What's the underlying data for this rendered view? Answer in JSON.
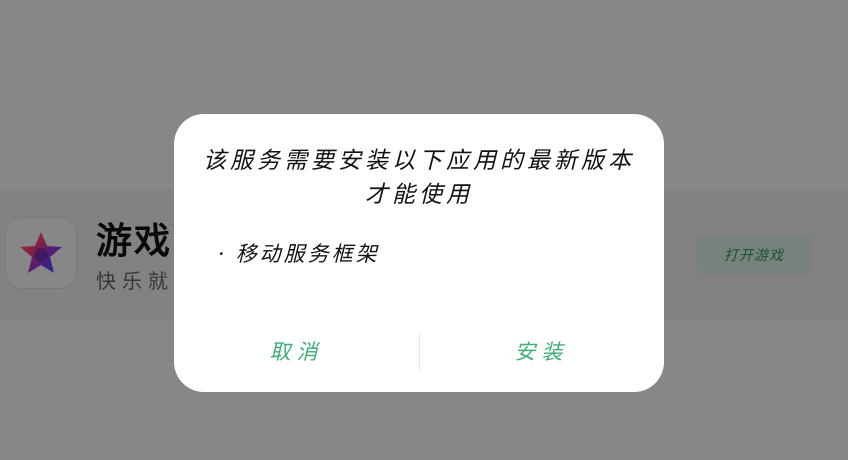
{
  "background_app": {
    "name": "游戏",
    "slogan": "快乐就",
    "open_button_label": "打开游戏"
  },
  "dialog": {
    "message": "该服务需要安装以下应用的最新版本才能使用",
    "items": [
      {
        "bullet": "·",
        "label": "移动服务框架"
      }
    ],
    "cancel_label": "取消",
    "install_label": "安装"
  },
  "colors": {
    "accent": "#3fae78",
    "scrim": "rgba(0,0,0,0.47)",
    "dialog_bg": "#ffffff"
  },
  "icons": {
    "app": "multicolor-star-icon"
  }
}
